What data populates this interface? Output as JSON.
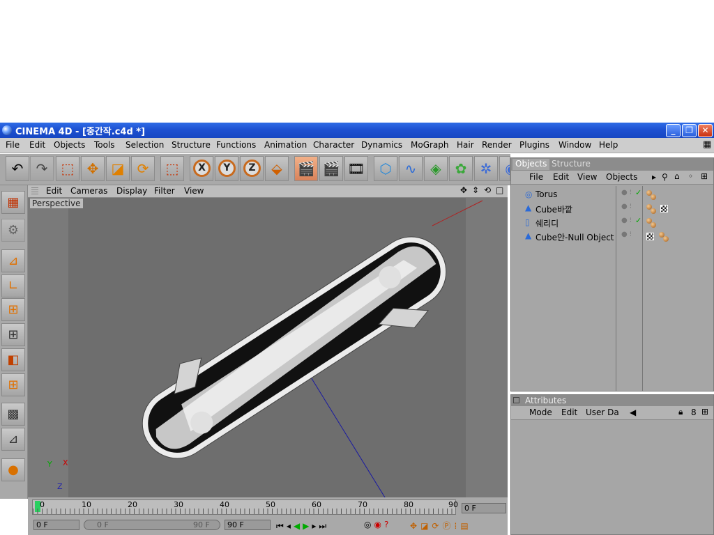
{
  "window": {
    "title": "CINEMA 4D - [중간작.c4d *]"
  },
  "menu": [
    "File",
    "Edit",
    "Objects",
    "Tools",
    "Selection",
    "Structure",
    "Functions",
    "Animation",
    "Character",
    "Dynamics",
    "MoGraph",
    "Hair",
    "Render",
    "Plugins",
    "Window",
    "Help"
  ],
  "viewport": {
    "menu": [
      "Edit",
      "Cameras",
      "Display",
      "Filter",
      "View"
    ],
    "label": "Perspective",
    "axis": {
      "x": "X",
      "y": "Y",
      "z": "Z"
    }
  },
  "objects": {
    "tabs": [
      "Objects",
      "Structure"
    ],
    "menu": [
      "File",
      "Edit",
      "View",
      "Objects"
    ],
    "items": [
      {
        "name": "Torus",
        "icon": "torus-icon"
      },
      {
        "name": "Cube바깥",
        "icon": "cone-icon"
      },
      {
        "name": "쉐리디",
        "icon": "cylinder-icon"
      },
      {
        "name": "Cube안-Null Object",
        "icon": "cone-icon"
      }
    ]
  },
  "attributes": {
    "title": "Attributes",
    "menu": [
      "Mode",
      "Edit",
      "User Da"
    ]
  },
  "timeline": {
    "ticks": [
      "0",
      "10",
      "20",
      "30",
      "40",
      "50",
      "60",
      "70",
      "80",
      "90"
    ],
    "current_frame": "0 F",
    "start": "0 F",
    "range_start": "0 F",
    "range_end": "90 F",
    "end": "90 F"
  },
  "colors": {
    "title_bar": "#1c4fd0",
    "panel": "#a9a9a9",
    "viewport": "#7a7a7a",
    "accent": "#d8825a"
  }
}
